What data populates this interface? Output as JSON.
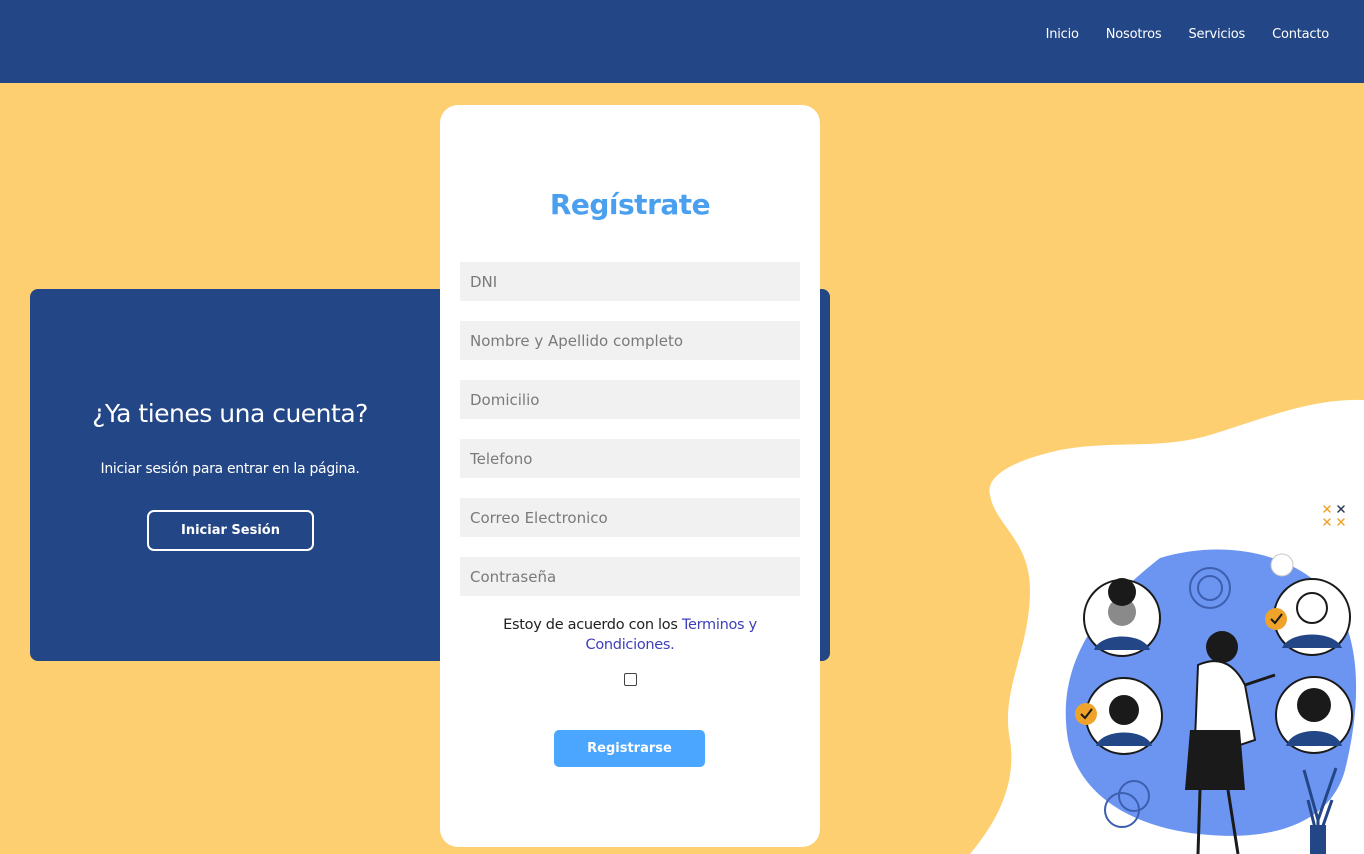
{
  "nav": {
    "items": [
      {
        "label": "Inicio"
      },
      {
        "label": "Nosotros"
      },
      {
        "label": "Servicios"
      },
      {
        "label": "Contacto"
      }
    ]
  },
  "login_panel": {
    "title": "¿Ya tienes una cuenta?",
    "subtitle": "Iniciar sesión para entrar en la página.",
    "button_label": "Iniciar Sesión"
  },
  "register": {
    "title": "Regístrate",
    "fields": {
      "dni": "DNI",
      "name": "Nombre y Apellido completo",
      "address": "Domicilio",
      "phone": "Telefono",
      "email": "Correo Electronico",
      "password": "Contraseña"
    },
    "terms_text": "Estoy de acuerdo con los ",
    "terms_link": "Terminos y Condiciones.",
    "accepted": false,
    "submit_label": "Registrarse"
  },
  "colors": {
    "header": "#234686",
    "background": "#fecf70",
    "accent": "#4aa6ff",
    "title": "#4aa0ee",
    "link": "#3d3fb8"
  },
  "icons": {
    "illustration": "team-illustration-icon",
    "decor": "cross-marks-icon"
  }
}
